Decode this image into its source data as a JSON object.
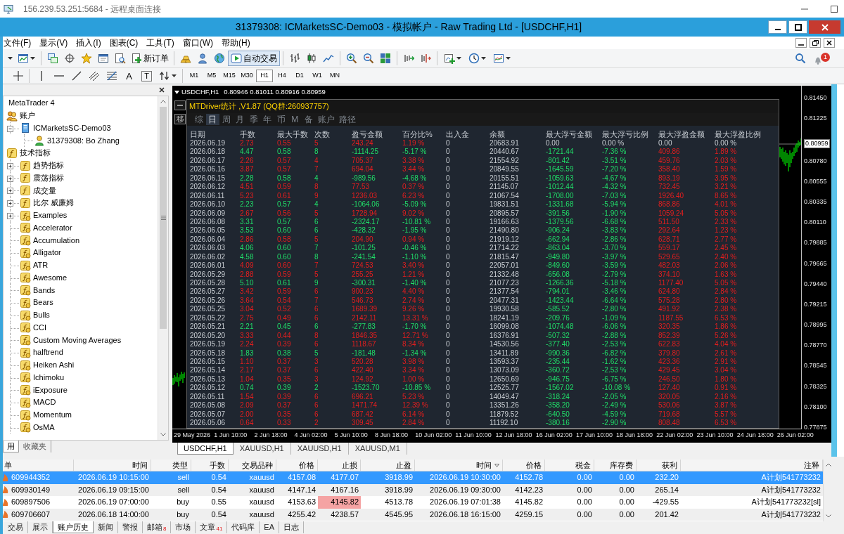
{
  "remote_desktop": {
    "title": "156.239.53.251:5684 - 远程桌面连接"
  },
  "window": {
    "title": "31379308: ICMarketsSC-Demo03 - 模拟帐户 - Raw Trading Ltd - [USDCHF,H1]"
  },
  "menu": [
    "文件(F)",
    "显示(V)",
    "插入(I)",
    "图表(C)",
    "工具(T)",
    "窗口(W)",
    "帮助(H)"
  ],
  "toolbar": {
    "new_order": "新订单",
    "autotrade": {
      "label": "自动交易",
      "on": true
    },
    "notification_count": "1"
  },
  "drawing_toolbar": {
    "text_tool": "A",
    "label_tool": "T",
    "timeframes": [
      {
        "label": "M1",
        "selected": false
      },
      {
        "label": "M5",
        "selected": false
      },
      {
        "label": "M15",
        "selected": false
      },
      {
        "label": "M30",
        "selected": false
      },
      {
        "label": "H1",
        "selected": true
      },
      {
        "label": "H4",
        "selected": false
      },
      {
        "label": "D1",
        "selected": false
      },
      {
        "label": "W1",
        "selected": false
      },
      {
        "label": "MN",
        "selected": false
      }
    ]
  },
  "navigator": {
    "tree": [
      {
        "label": "MetaTrader 4",
        "children": [
          {
            "label": "账户",
            "kind": "accounts",
            "children": [
              {
                "label": "ICMarketsSC-Demo03",
                "kind": "server",
                "expanded": true,
                "children": [
                  {
                    "label": "31379308: Bo Zhang",
                    "kind": "user"
                  }
                ]
              }
            ]
          },
          {
            "label": "技术指标",
            "kind": "folder",
            "children": [
              {
                "label": "趋势指标",
                "kind": "folder",
                "expanded": false
              },
              {
                "label": "震荡指标",
                "kind": "folder",
                "expanded": false
              },
              {
                "label": "成交量",
                "kind": "folder",
                "expanded": false
              },
              {
                "label": "比尔 威廉姆",
                "kind": "folder",
                "expanded": false
              },
              {
                "label": "Examples",
                "kind": "indicator",
                "expanded": false
              },
              {
                "label": "Accelerator",
                "kind": "indicator"
              },
              {
                "label": "Accumulation",
                "kind": "indicator"
              },
              {
                "label": "Alligator",
                "kind": "indicator"
              },
              {
                "label": "ATR",
                "kind": "indicator"
              },
              {
                "label": "Awesome",
                "kind": "indicator"
              },
              {
                "label": "Bands",
                "kind": "indicator"
              },
              {
                "label": "Bears",
                "kind": "indicator"
              },
              {
                "label": "Bulls",
                "kind": "indicator"
              },
              {
                "label": "CCI",
                "kind": "indicator"
              },
              {
                "label": "Custom Moving Averages",
                "kind": "indicator"
              },
              {
                "label": "halftrend",
                "kind": "indicator"
              },
              {
                "label": "Heiken Ashi",
                "kind": "indicator"
              },
              {
                "label": "Ichimoku",
                "kind": "indicator"
              },
              {
                "label": "iExposure",
                "kind": "indicator"
              },
              {
                "label": "MACD",
                "kind": "indicator"
              },
              {
                "label": "Momentum",
                "kind": "indicator"
              },
              {
                "label": "OsMA",
                "kind": "indicator"
              }
            ]
          }
        ]
      }
    ],
    "tabs": [
      {
        "label": "用",
        "selected": true
      },
      {
        "label": "收藏夹",
        "selected": false
      }
    ]
  },
  "chart": {
    "symbol": "USDCHF,H1",
    "quote": "0.80946 0.81011 0.80916 0.80959",
    "price_axis": [
      {
        "text": "0.81450",
        "kind": "tick"
      },
      {
        "text": "0.81225",
        "kind": "tick"
      },
      {
        "text": "0.80959",
        "kind": "current"
      },
      {
        "text": "0.80780",
        "kind": "tick"
      },
      {
        "text": "0.80555",
        "kind": "tick"
      },
      {
        "text": "0.80335",
        "kind": "tick"
      },
      {
        "text": "0.80110",
        "kind": "tick"
      },
      {
        "text": "0.79885",
        "kind": "tick"
      },
      {
        "text": "0.79665",
        "kind": "tick"
      },
      {
        "text": "0.79440",
        "kind": "tick"
      },
      {
        "text": "0.79215",
        "kind": "tick"
      },
      {
        "text": "0.78995",
        "kind": "tick"
      },
      {
        "text": "0.78770",
        "kind": "tick"
      },
      {
        "text": "0.78545",
        "kind": "tick"
      },
      {
        "text": "0.78325",
        "kind": "tick"
      },
      {
        "text": "0.78100",
        "kind": "tick"
      },
      {
        "text": "0.77875",
        "kind": "tick"
      }
    ],
    "time_axis": [
      "29 May 2026",
      "1 Jun 10:00",
      "2 Jun 18:00",
      "4 Jun 02:00",
      "5 Jun 10:00",
      "8 Jun 18:00",
      "10 Jun 02:00",
      "11 Jun 10:00",
      "12 Jun 18:00",
      "16 Jun 02:00",
      "17 Jun 10:00",
      "18 Jun 18:00",
      "22 Jun 02:00",
      "23 Jun 10:00",
      "24 Jun 18:00",
      "26 Jun 02:00"
    ],
    "tabs": [
      {
        "label": "USDCHF,H1",
        "selected": true
      },
      {
        "label": "XAUUSD,H1",
        "selected": false
      },
      {
        "label": "XAUUSD,H1",
        "selected": false
      },
      {
        "label": "XAUUSD,M1",
        "selected": false
      }
    ]
  },
  "stats_panel": {
    "title": "MTDriver统计 ,V1.87 (QQ群:260937757)",
    "move_button": "移",
    "tabs": [
      {
        "label": "综",
        "selected": false
      },
      {
        "label": "日",
        "selected": true
      },
      {
        "label": "周",
        "selected": false
      },
      {
        "label": "月",
        "selected": false
      },
      {
        "label": "季",
        "selected": false
      },
      {
        "label": "年",
        "selected": false
      },
      {
        "label": "币",
        "selected": false
      },
      {
        "label": "M",
        "selected": false
      },
      {
        "label": "备",
        "selected": false
      },
      {
        "label": "账户",
        "selected": false
      },
      {
        "label": "路径",
        "selected": false
      }
    ],
    "columns": [
      "日期",
      "手数",
      "最大手数",
      "次数",
      "盈亏金额",
      "百分比%",
      "出入金",
      "余额",
      "最大浮亏金额",
      "最大浮亏比例",
      "最大浮盈金额",
      "最大浮盈比例"
    ],
    "rows": [
      {
        "kind": "gain",
        "float_marked": false,
        "cells": [
          "2026.06.19",
          "2.73",
          "0.55",
          "5",
          "243.24",
          "1.19 %",
          "0",
          "20683.91",
          "0.00",
          "0.00 %",
          "0.00",
          "0.00 %"
        ]
      },
      {
        "kind": "loss",
        "float_marked": true,
        "cells": [
          "2026.06.18",
          "4.47",
          "0.58",
          "8",
          "-1114.25",
          "-5.17 %",
          "0",
          "20440.67",
          "-1721.44",
          "-7.36 %",
          "409.86",
          "1.89 %"
        ]
      },
      {
        "kind": "gain",
        "float_marked": true,
        "cells": [
          "2026.06.17",
          "2.26",
          "0.57",
          "4",
          "705.37",
          "3.38 %",
          "0",
          "21554.92",
          "-801.42",
          "-3.51 %",
          "459.76",
          "2.03 %"
        ]
      },
      {
        "kind": "gain",
        "float_marked": true,
        "cells": [
          "2026.06.16",
          "3.87",
          "0.57",
          "7",
          "694.04",
          "3.44 %",
          "0",
          "20849.55",
          "-1645.59",
          "-7.20 %",
          "358.40",
          "1.59 %"
        ]
      },
      {
        "kind": "loss",
        "float_marked": true,
        "cells": [
          "2026.06.15",
          "2.28",
          "0.58",
          "4",
          "-989.56",
          "-4.68 %",
          "0",
          "20155.51",
          "-1059.63",
          "-4.67 %",
          "893.19",
          "3.95 %"
        ]
      },
      {
        "kind": "gain",
        "float_marked": true,
        "cells": [
          "2026.06.12",
          "4.51",
          "0.59",
          "8",
          "77.53",
          "0.37 %",
          "0",
          "21145.07",
          "-1012.44",
          "-4.32 %",
          "732.45",
          "3.21 %"
        ]
      },
      {
        "kind": "gain",
        "float_marked": true,
        "cells": [
          "2026.06.11",
          "5.23",
          "0.61",
          "9",
          "1236.03",
          "6.23 %",
          "0",
          "21067.54",
          "-1708.00",
          "-7.03 %",
          "1926.40",
          "8.65 %"
        ]
      },
      {
        "kind": "loss",
        "float_marked": true,
        "cells": [
          "2026.06.10",
          "2.23",
          "0.57",
          "4",
          "-1064.06",
          "-5.09 %",
          "0",
          "19831.51",
          "-1331.68",
          "-5.94 %",
          "868.86",
          "4.01 %"
        ]
      },
      {
        "kind": "gain",
        "float_marked": true,
        "cells": [
          "2026.06.09",
          "2.67",
          "0.56",
          "5",
          "1728.94",
          "9.02 %",
          "0",
          "20895.57",
          "-391.56",
          "-1.90 %",
          "1059.24",
          "5.05 %"
        ]
      },
      {
        "kind": "loss",
        "float_marked": true,
        "cells": [
          "2026.06.08",
          "3.31",
          "0.57",
          "6",
          "-2324.17",
          "-10.81 %",
          "0",
          "19166.63",
          "-1379.56",
          "-6.68 %",
          "511.50",
          "2.33 %"
        ]
      },
      {
        "kind": "loss",
        "float_marked": true,
        "cells": [
          "2026.06.05",
          "3.53",
          "0.60",
          "6",
          "-428.32",
          "-1.95 %",
          "0",
          "21490.80",
          "-906.24",
          "-3.83 %",
          "292.64",
          "1.23 %"
        ]
      },
      {
        "kind": "gain",
        "float_marked": true,
        "cells": [
          "2026.06.04",
          "2.86",
          "0.58",
          "5",
          "204.90",
          "0.94 %",
          "0",
          "21919.12",
          "-662.94",
          "-2.86 %",
          "628.71",
          "2.77 %"
        ]
      },
      {
        "kind": "loss",
        "float_marked": true,
        "cells": [
          "2026.06.03",
          "4.06",
          "0.60",
          "7",
          "-101.25",
          "-0.46 %",
          "0",
          "21714.22",
          "-863.04",
          "-3.70 %",
          "559.17",
          "2.45 %"
        ]
      },
      {
        "kind": "loss",
        "float_marked": true,
        "cells": [
          "2026.06.02",
          "4.58",
          "0.60",
          "8",
          "-241.54",
          "-1.10 %",
          "0",
          "21815.47",
          "-949.80",
          "-3.97 %",
          "529.65",
          "2.40 %"
        ]
      },
      {
        "kind": "gain",
        "float_marked": true,
        "cells": [
          "2026.06.01",
          "4.09",
          "0.60",
          "7",
          "724.53",
          "3.40 %",
          "0",
          "22057.01",
          "-849.60",
          "-3.59 %",
          "482.03",
          "2.06 %"
        ]
      },
      {
        "kind": "gain",
        "float_marked": true,
        "cells": [
          "2026.05.29",
          "2.88",
          "0.59",
          "5",
          "255.25",
          "1.21 %",
          "0",
          "21332.48",
          "-656.08",
          "-2.79 %",
          "374.10",
          "1.63 %"
        ]
      },
      {
        "kind": "loss",
        "float_marked": true,
        "cells": [
          "2026.05.28",
          "5.10",
          "0.61",
          "9",
          "-300.31",
          "-1.40 %",
          "0",
          "21077.23",
          "-1266.36",
          "-5.18 %",
          "1177.40",
          "5.05 %"
        ]
      },
      {
        "kind": "gain",
        "float_marked": true,
        "cells": [
          "2026.05.27",
          "3.42",
          "0.59",
          "6",
          "900.23",
          "4.40 %",
          "0",
          "21377.54",
          "-794.01",
          "-3.46 %",
          "624.80",
          "2.84 %"
        ]
      },
      {
        "kind": "gain",
        "float_marked": true,
        "cells": [
          "2026.05.26",
          "3.64",
          "0.54",
          "7",
          "546.73",
          "2.74 %",
          "0",
          "20477.31",
          "-1423.44",
          "-6.64 %",
          "575.28",
          "2.80 %"
        ]
      },
      {
        "kind": "gain",
        "float_marked": true,
        "cells": [
          "2026.05.25",
          "3.04",
          "0.52",
          "6",
          "1689.39",
          "9.26 %",
          "0",
          "19930.58",
          "-585.52",
          "-2.80 %",
          "491.92",
          "2.38 %"
        ]
      },
      {
        "kind": "gain",
        "float_marked": true,
        "cells": [
          "2026.05.22",
          "2.75",
          "0.49",
          "6",
          "2142.11",
          "13.31 %",
          "0",
          "18241.19",
          "-209.76",
          "-1.09 %",
          "1187.55",
          "6.53 %"
        ]
      },
      {
        "kind": "loss",
        "float_marked": true,
        "cells": [
          "2026.05.21",
          "2.21",
          "0.45",
          "6",
          "-277.83",
          "-1.70 %",
          "0",
          "16099.08",
          "-1074.48",
          "-6.06 %",
          "320.35",
          "1.86 %"
        ]
      },
      {
        "kind": "gain",
        "float_marked": true,
        "cells": [
          "2026.05.20",
          "3.33",
          "0.44",
          "8",
          "1846.35",
          "12.71 %",
          "0",
          "16376.91",
          "-507.32",
          "-2.88 %",
          "852.39",
          "5.26 %"
        ]
      },
      {
        "kind": "gain",
        "float_marked": true,
        "cells": [
          "2026.05.19",
          "2.24",
          "0.39",
          "6",
          "1118.67",
          "8.34 %",
          "0",
          "14530.56",
          "-377.40",
          "-2.53 %",
          "622.83",
          "4.04 %"
        ]
      },
      {
        "kind": "loss",
        "float_marked": true,
        "cells": [
          "2026.05.18",
          "1.83",
          "0.38",
          "5",
          "-181.48",
          "-1.34 %",
          "0",
          "13411.89",
          "-990.36",
          "-6.82 %",
          "379.80",
          "2.61 %"
        ]
      },
      {
        "kind": "gain",
        "float_marked": true,
        "cells": [
          "2026.05.15",
          "1.10",
          "0.37",
          "3",
          "520.28",
          "3.98 %",
          "0",
          "13593.37",
          "-235.44",
          "-1.62 %",
          "423.36",
          "2.91 %"
        ]
      },
      {
        "kind": "gain",
        "float_marked": true,
        "cells": [
          "2026.05.14",
          "2.17",
          "0.37",
          "6",
          "422.40",
          "3.34 %",
          "0",
          "13073.09",
          "-360.72",
          "-2.53 %",
          "429.45",
          "3.04 %"
        ]
      },
      {
        "kind": "gain",
        "float_marked": true,
        "cells": [
          "2026.05.13",
          "1.04",
          "0.35",
          "3",
          "124.92",
          "1.00 %",
          "0",
          "12650.69",
          "-946.75",
          "-6.75 %",
          "246.50",
          "1.80 %"
        ]
      },
      {
        "kind": "loss",
        "float_marked": true,
        "cells": [
          "2026.05.12",
          "0.74",
          "0.39",
          "2",
          "-1523.70",
          "-10.85 %",
          "0",
          "12525.77",
          "-1567.02",
          "-10.08 %",
          "127.40",
          "0.91 %"
        ]
      },
      {
        "kind": "gain",
        "float_marked": true,
        "cells": [
          "2026.05.11",
          "1.54",
          "0.39",
          "6",
          "696.21",
          "5.23 %",
          "0",
          "14049.47",
          "-318.24",
          "-2.05 %",
          "320.05",
          "2.16 %"
        ]
      },
      {
        "kind": "gain",
        "float_marked": true,
        "cells": [
          "2026.05.08",
          "2.09",
          "0.37",
          "6",
          "1471.74",
          "12.39 %",
          "0",
          "13351.26",
          "-358.20",
          "-2.49 %",
          "530.06",
          "3.87 %"
        ]
      },
      {
        "kind": "gain",
        "float_marked": true,
        "cells": [
          "2026.05.07",
          "2.00",
          "0.35",
          "6",
          "687.42",
          "6.14 %",
          "0",
          "11879.52",
          "-640.50",
          "-4.59 %",
          "719.68",
          "5.57 %"
        ]
      },
      {
        "kind": "gain",
        "float_marked": true,
        "cells": [
          "2026.05.06",
          "0.64",
          "0.33",
          "2",
          "309.45",
          "2.84 %",
          "0",
          "11192.10",
          "-380.16",
          "-2.90 %",
          "808.48",
          "6.53 %"
        ]
      }
    ]
  },
  "terminal": {
    "columns": [
      {
        "label": "单",
        "sorted": false
      },
      {
        "label": "时间",
        "sorted": false
      },
      {
        "label": "类型",
        "sorted": false
      },
      {
        "label": "手数",
        "sorted": false
      },
      {
        "label": "交易品种",
        "sorted": false
      },
      {
        "label": "价格",
        "sorted": false
      },
      {
        "label": "止损",
        "sorted": false
      },
      {
        "label": "止盈",
        "sorted": false
      },
      {
        "label": "时间",
        "sorted": true
      },
      {
        "label": "价格",
        "sorted": false
      },
      {
        "label": "税金",
        "sorted": false
      },
      {
        "label": "库存费",
        "sorted": false
      },
      {
        "label": "获利",
        "sorted": false
      },
      {
        "label": "注释",
        "sorted": false
      }
    ],
    "rows": [
      {
        "selected": true,
        "sl_hit": false,
        "cells": [
          "609944352",
          "2026.06.19 10:15:00",
          "sell",
          "0.54",
          "xauusd",
          "4157.08",
          "4177.07",
          "3918.99",
          "2026.06.19 10:30:00",
          "4152.78",
          "0.00",
          "0.00",
          "232.20",
          "A计划541773232"
        ]
      },
      {
        "selected": false,
        "sl_hit": false,
        "cells": [
          "609930149",
          "2026.06.19 09:15:00",
          "sell",
          "0.54",
          "xauusd",
          "4147.14",
          "4167.16",
          "3918.99",
          "2026.06.19 09:30:00",
          "4142.23",
          "0.00",
          "0.00",
          "265.14",
          "A计划541773232"
        ]
      },
      {
        "selected": false,
        "sl_hit": true,
        "cells": [
          "609897506",
          "2026.06.19 07:00:00",
          "buy",
          "0.55",
          "xauusd",
          "4153.63",
          "4145.82",
          "4513.78",
          "2026.06.19 07:01:38",
          "4145.82",
          "0.00",
          "0.00",
          "-429.55",
          "A计划541773232[sl]"
        ]
      },
      {
        "selected": false,
        "sl_hit": false,
        "cells": [
          "609706607",
          "2026.06.18 14:00:00",
          "buy",
          "0.54",
          "xauusd",
          "4255.42",
          "4238.57",
          "4545.95",
          "2026.06.18 16:15:00",
          "4259.15",
          "0.00",
          "0.00",
          "201.42",
          "A计划541773232"
        ]
      }
    ],
    "tabs": [
      {
        "label": "交易",
        "selected": false
      },
      {
        "label": "展示",
        "selected": false
      },
      {
        "label": "账户历史",
        "selected": true
      },
      {
        "label": "新闻",
        "selected": false
      },
      {
        "label": "警报",
        "selected": false
      },
      {
        "label": "邮箱",
        "selected": false,
        "badge": "8"
      },
      {
        "label": "市场",
        "selected": false
      },
      {
        "label": "文章",
        "selected": false,
        "badge": "41"
      },
      {
        "label": "代码库",
        "selected": false
      },
      {
        "label": "EA",
        "selected": false
      },
      {
        "label": "日志",
        "selected": false
      }
    ]
  }
}
